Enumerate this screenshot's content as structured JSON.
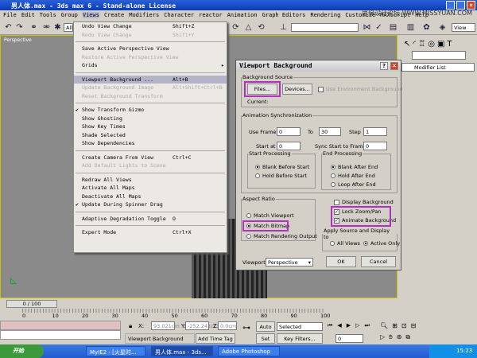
{
  "window": {
    "title": "男人体.max - 3ds max 6 - Stand-alone License"
  },
  "menubar": {
    "items": [
      "File",
      "Edit",
      "Tools",
      "Group",
      "Views",
      "Create",
      "Modifiers",
      "Character",
      "reactor",
      "Animation",
      "Graph Editors",
      "Rendering",
      "Customize",
      "MAXScript",
      "Help"
    ],
    "watermark": "思缘设计论坛 WWW.MISSYUAN.COM"
  },
  "toolbar": {
    "selection_filter": "All",
    "view_dropdown": "View"
  },
  "viewport": {
    "label": "Perspective"
  },
  "command_panel": {
    "modifier_list": "Modifier List"
  },
  "views_menu": {
    "items": [
      {
        "label": "Undo View Change",
        "shortcut": "Shift+Z",
        "disabled": false
      },
      {
        "label": "Redo View Change",
        "shortcut": "Shift+Y",
        "disabled": true
      },
      {
        "sep": true
      },
      {
        "label": "Save Active Perspective View",
        "disabled": false
      },
      {
        "label": "Restore Active Perspective View",
        "disabled": true
      },
      {
        "label": "Grids",
        "submenu": true
      },
      {
        "sep": true
      },
      {
        "label": "Viewport Background ...",
        "shortcut": "Alt+B",
        "highlighted": true
      },
      {
        "label": "Update Background Image",
        "shortcut": "Alt+Shift+Ctrl+B",
        "disabled": true
      },
      {
        "label": "Reset Background Transform",
        "disabled": true
      },
      {
        "sep": true
      },
      {
        "label": "Show Transform Gizmo",
        "checked": true
      },
      {
        "label": "Show Ghosting"
      },
      {
        "label": "Show Key Times"
      },
      {
        "label": "Shade Selected"
      },
      {
        "label": "Show Dependencies"
      },
      {
        "sep": true
      },
      {
        "label": "Create Camera From View",
        "shortcut": "Ctrl+C"
      },
      {
        "label": "Add Default Lights to Scene",
        "disabled": true
      },
      {
        "sep": true
      },
      {
        "label": "Redraw All Views"
      },
      {
        "label": "Activate All Maps"
      },
      {
        "label": "Deactivate All Maps"
      },
      {
        "label": "Update During Spinner Drag",
        "checked": true
      },
      {
        "sep": true
      },
      {
        "label": "Adaptive Degradation Toggle",
        "shortcut": "O"
      },
      {
        "sep": true
      },
      {
        "label": "Expert Mode",
        "shortcut": "Ctrl+X"
      }
    ]
  },
  "dialog": {
    "title": "Viewport Background",
    "background_source": {
      "legend": "Background Source",
      "files": "Files...",
      "devices": "Devices...",
      "use_env": "Use Environment Background",
      "current": "Current:"
    },
    "anim_sync": {
      "legend": "Animation Synchronization",
      "use_frame": "Use Frame",
      "use_frame_val": "0",
      "to": "To",
      "to_val": "30",
      "step": "Step",
      "step_val": "1",
      "start_at": "Start at",
      "start_at_val": "0",
      "sync_start": "Sync Start to Frame",
      "sync_start_val": "0"
    },
    "start_processing": {
      "legend": "Start Processing",
      "blank": "Blank Before Start",
      "hold": "Hold Before Start",
      "selected": "blank"
    },
    "end_processing": {
      "legend": "End Processing",
      "blank": "Blank After End",
      "hold": "Hold After End",
      "loop": "Loop After End",
      "selected": "blank"
    },
    "aspect_ratio": {
      "legend": "Aspect Ratio",
      "viewport": "Match Viewport",
      "bitmap": "Match Bitmap",
      "rendering": "Match Rendering Output",
      "selected": "bitmap"
    },
    "display_background": {
      "label": "Display Background",
      "checked": false
    },
    "lock_zoom": {
      "label": "Lock Zoom/Pan",
      "checked": true
    },
    "animate_bg": {
      "label": "Animate Background",
      "checked": true
    },
    "apply": {
      "legend": "Apply Source and Display to",
      "all": "All Views",
      "active": "Active Only",
      "selected": "active"
    },
    "viewport_label": "Viewport:",
    "viewport_value": "Perspective",
    "ok": "OK",
    "cancel": "Cancel",
    "highlight_color": "#b030c0"
  },
  "timeline": {
    "frame": "0 / 100",
    "ticks": [
      "0",
      "10",
      "20",
      "30",
      "40",
      "50",
      "60",
      "70",
      "80",
      "90",
      "100"
    ]
  },
  "status": {
    "x_label": "X:",
    "x": "93.021cm",
    "y_label": "Y:",
    "y": "-252.241cr",
    "z_label": "Z:",
    "z": "0.0cm",
    "prompt": "Viewport Background",
    "add_time_tag": "Add Time Tag",
    "auto_key": "Auto Key",
    "selected": "Selected",
    "set_key": "Set Key",
    "key_filters": "Key Filters...",
    "current_frame": "0"
  },
  "taskbar": {
    "start": "开始",
    "tasks": [
      "MyIE2 - [火星时...",
      "男人体.max - 3ds...",
      "Adobe Photoshop"
    ],
    "clock": "15:23"
  }
}
